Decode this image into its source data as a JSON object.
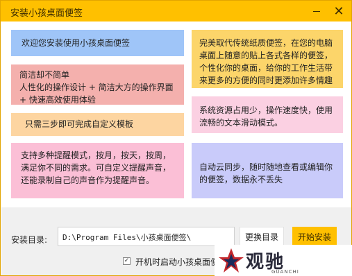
{
  "window": {
    "title": "安装小孩桌面便签",
    "minimize_glyph": "—",
    "close_glyph": "✕"
  },
  "notes": [
    {
      "text": "欢迎您安装使用小孩桌面便签",
      "color": "#9fc5f8"
    },
    {
      "text": "简洁却不简单\n人性化的操作设计 + 简洁大方的操作界面 + 快速高效使用体验",
      "color": "#f4b0ad"
    },
    {
      "text": "只需三步即可完成自定义模板",
      "color": "#fdd5a1"
    },
    {
      "text": "支持多种提醒模式，按月，按天，按周，满足你不同的需求。可自定义提醒声音，还能录制自己的声音作为提醒声音。",
      "color": "#fbbfd6"
    },
    {
      "text": "完美取代传统纸质便签，在您的电脑桌面上随意的贴上各式各样的便签，个性化你的桌面，给你的工作生活带来更多的方便的同时更添加许多情趣",
      "color": "#fcd56a"
    },
    {
      "text": "系统资源占用少，操作速度快，使用流畅的文本滑动模式。",
      "color": "#fbd0e2"
    },
    {
      "text": "自动云同步，随时随地查看或编辑你的便签，数据永不丢失",
      "color": "#c9cbfa"
    }
  ],
  "install": {
    "dir_label": "安装目录:",
    "dir_value": "D:\\Program Files\\小孩桌面便签\\",
    "change_button": "更换目录",
    "start_button": "开始安装",
    "autostart_label": "开机时启动小孩桌面便签",
    "autostart_checked": true,
    "check_glyph": "✓"
  },
  "watermark": {
    "text": "观驰",
    "sub": "GUANCHI"
  }
}
